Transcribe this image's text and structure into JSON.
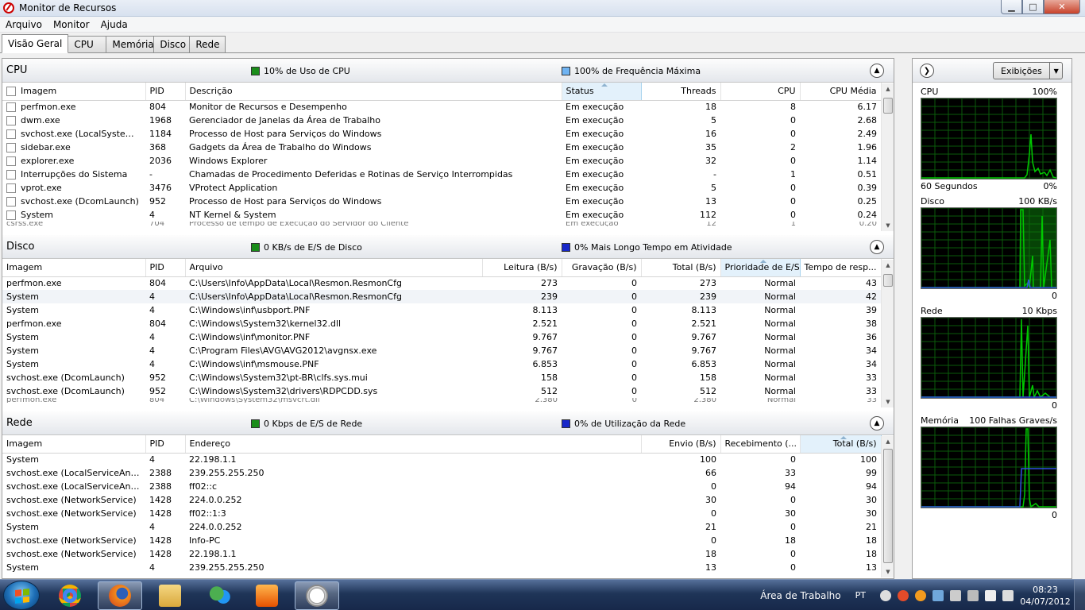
{
  "window": {
    "title": "Monitor de Recursos",
    "min": "▁",
    "max": "□",
    "close": "✕"
  },
  "menu": [
    "Arquivo",
    "Monitor",
    "Ajuda"
  ],
  "tabs": [
    "Visão Geral",
    "CPU",
    "Memória",
    "Disco",
    "Rede"
  ],
  "cpu": {
    "title": "CPU",
    "stat1": "10% de Uso de CPU",
    "stat2": "100% de Frequência Máxima",
    "columns": [
      "Imagem",
      "PID",
      "Descrição",
      "Status",
      "Threads",
      "CPU",
      "CPU Média"
    ],
    "rows": [
      [
        "perfmon.exe",
        "804",
        "Monitor de Recursos e Desempenho",
        "Em execução",
        "18",
        "8",
        "6.17"
      ],
      [
        "dwm.exe",
        "1968",
        "Gerenciador de Janelas da Área de Trabalho",
        "Em execução",
        "5",
        "0",
        "2.68"
      ],
      [
        "svchost.exe (LocalSystemNet...",
        "1184",
        "Processo de Host para Serviços do Windows",
        "Em execução",
        "16",
        "0",
        "2.49"
      ],
      [
        "sidebar.exe",
        "368",
        "Gadgets da Área de Trabalho do Windows",
        "Em execução",
        "35",
        "2",
        "1.96"
      ],
      [
        "explorer.exe",
        "2036",
        "Windows Explorer",
        "Em execução",
        "32",
        "0",
        "1.14"
      ],
      [
        "Interrupções do Sistema",
        "-",
        "Chamadas de Procedimento Deferidas e Rotinas de Serviço Interrompidas",
        "Em execução",
        "-",
        "1",
        "0.51"
      ],
      [
        "vprot.exe",
        "3476",
        "VProtect Application",
        "Em execução",
        "5",
        "0",
        "0.39"
      ],
      [
        "svchost.exe (DcomLaunch)",
        "952",
        "Processo de Host para Serviços do Windows",
        "Em execução",
        "13",
        "0",
        "0.25"
      ],
      [
        "System",
        "4",
        "NT Kernel & System",
        "Em execução",
        "112",
        "0",
        "0.24"
      ]
    ],
    "partial": [
      "csrss.exe",
      "704",
      "Processo de tempo de Execução do Servidor do Cliente",
      "Em execução",
      "12",
      "1",
      "0.20"
    ]
  },
  "disk": {
    "title": "Disco",
    "stat1": "0 KB/s de E/S de Disco",
    "stat2": "0% Mais Longo Tempo em Atividade",
    "columns": [
      "Imagem",
      "PID",
      "Arquivo",
      "Leitura (B/s)",
      "Gravação (B/s)",
      "Total (B/s)",
      "Prioridade de E/S",
      "Tempo de resp..."
    ],
    "rows": [
      [
        "perfmon.exe",
        "804",
        "C:\\Users\\Info\\AppData\\Local\\Resmon.ResmonCfg",
        "273",
        "0",
        "273",
        "Normal",
        "43"
      ],
      [
        "System",
        "4",
        "C:\\Users\\Info\\AppData\\Local\\Resmon.ResmonCfg",
        "239",
        "0",
        "239",
        "Normal",
        "42"
      ],
      [
        "System",
        "4",
        "C:\\Windows\\inf\\usbport.PNF",
        "8.113",
        "0",
        "8.113",
        "Normal",
        "39"
      ],
      [
        "perfmon.exe",
        "804",
        "C:\\Windows\\System32\\kernel32.dll",
        "2.521",
        "0",
        "2.521",
        "Normal",
        "38"
      ],
      [
        "System",
        "4",
        "C:\\Windows\\inf\\monitor.PNF",
        "9.767",
        "0",
        "9.767",
        "Normal",
        "36"
      ],
      [
        "System",
        "4",
        "C:\\Program Files\\AVG\\AVG2012\\avgnsx.exe",
        "9.767",
        "0",
        "9.767",
        "Normal",
        "34"
      ],
      [
        "System",
        "4",
        "C:\\Windows\\inf\\msmouse.PNF",
        "6.853",
        "0",
        "6.853",
        "Normal",
        "34"
      ],
      [
        "svchost.exe (DcomLaunch)",
        "952",
        "C:\\Windows\\System32\\pt-BR\\clfs.sys.mui",
        "158",
        "0",
        "158",
        "Normal",
        "33"
      ],
      [
        "svchost.exe (DcomLaunch)",
        "952",
        "C:\\Windows\\System32\\drivers\\RDPCDD.sys",
        "512",
        "0",
        "512",
        "Normal",
        "33"
      ]
    ],
    "partial": [
      "perfmon.exe",
      "804",
      "C:\\Windows\\System32\\msvcrt.dll",
      "2.380",
      "0",
      "2.380",
      "Normal",
      "33"
    ]
  },
  "net": {
    "title": "Rede",
    "stat1": "0 Kbps de E/S de Rede",
    "stat2": "0% de Utilização da Rede",
    "columns": [
      "Imagem",
      "PID",
      "Endereço",
      "Envio (B/s)",
      "Recebimento (...",
      "Total (B/s)"
    ],
    "rows": [
      [
        "System",
        "4",
        "22.198.1.1",
        "100",
        "0",
        "100"
      ],
      [
        "svchost.exe (LocalServiceAndNo...",
        "2388",
        "239.255.255.250",
        "66",
        "33",
        "99"
      ],
      [
        "svchost.exe (LocalServiceAndNo...",
        "2388",
        "ff02::c",
        "0",
        "94",
        "94"
      ],
      [
        "svchost.exe (NetworkService)",
        "1428",
        "224.0.0.252",
        "30",
        "0",
        "30"
      ],
      [
        "svchost.exe (NetworkService)",
        "1428",
        "ff02::1:3",
        "0",
        "30",
        "30"
      ],
      [
        "System",
        "4",
        "224.0.0.252",
        "21",
        "0",
        "21"
      ],
      [
        "svchost.exe (NetworkService)",
        "1428",
        "Info-PC",
        "0",
        "18",
        "18"
      ],
      [
        "svchost.exe (NetworkService)",
        "1428",
        "22.198.1.1",
        "18",
        "0",
        "18"
      ],
      [
        "System",
        "4",
        "239.255.255.250",
        "13",
        "0",
        "13"
      ]
    ]
  },
  "side": {
    "views_label": "Exibições",
    "graphs": [
      {
        "name": "CPU",
        "max": "100%",
        "bottom_left": "60 Segundos",
        "bottom_right": "0%"
      },
      {
        "name": "Disco",
        "max": "100 KB/s",
        "bottom_left": "",
        "bottom_right": "0"
      },
      {
        "name": "Rede",
        "max": "10 Kbps",
        "bottom_left": "",
        "bottom_right": "0"
      },
      {
        "name": "Memória",
        "max": "100 Falhas Graves/s",
        "bottom_left": "",
        "bottom_right": "0"
      }
    ]
  },
  "taskbar": {
    "apps": [
      "chrome-icon",
      "firefox-icon",
      "explorer-icon",
      "messenger-icon",
      "media-player-icon",
      "resource-monitor-icon"
    ],
    "desktop_label": "Área de Trabalho",
    "lang": "PT",
    "time": "08:23",
    "date": "04/07/2012"
  },
  "colors": {
    "graph_green": "#00c800",
    "graph_grid": "#0a5a0a",
    "graph_blue": "#3050e0"
  }
}
